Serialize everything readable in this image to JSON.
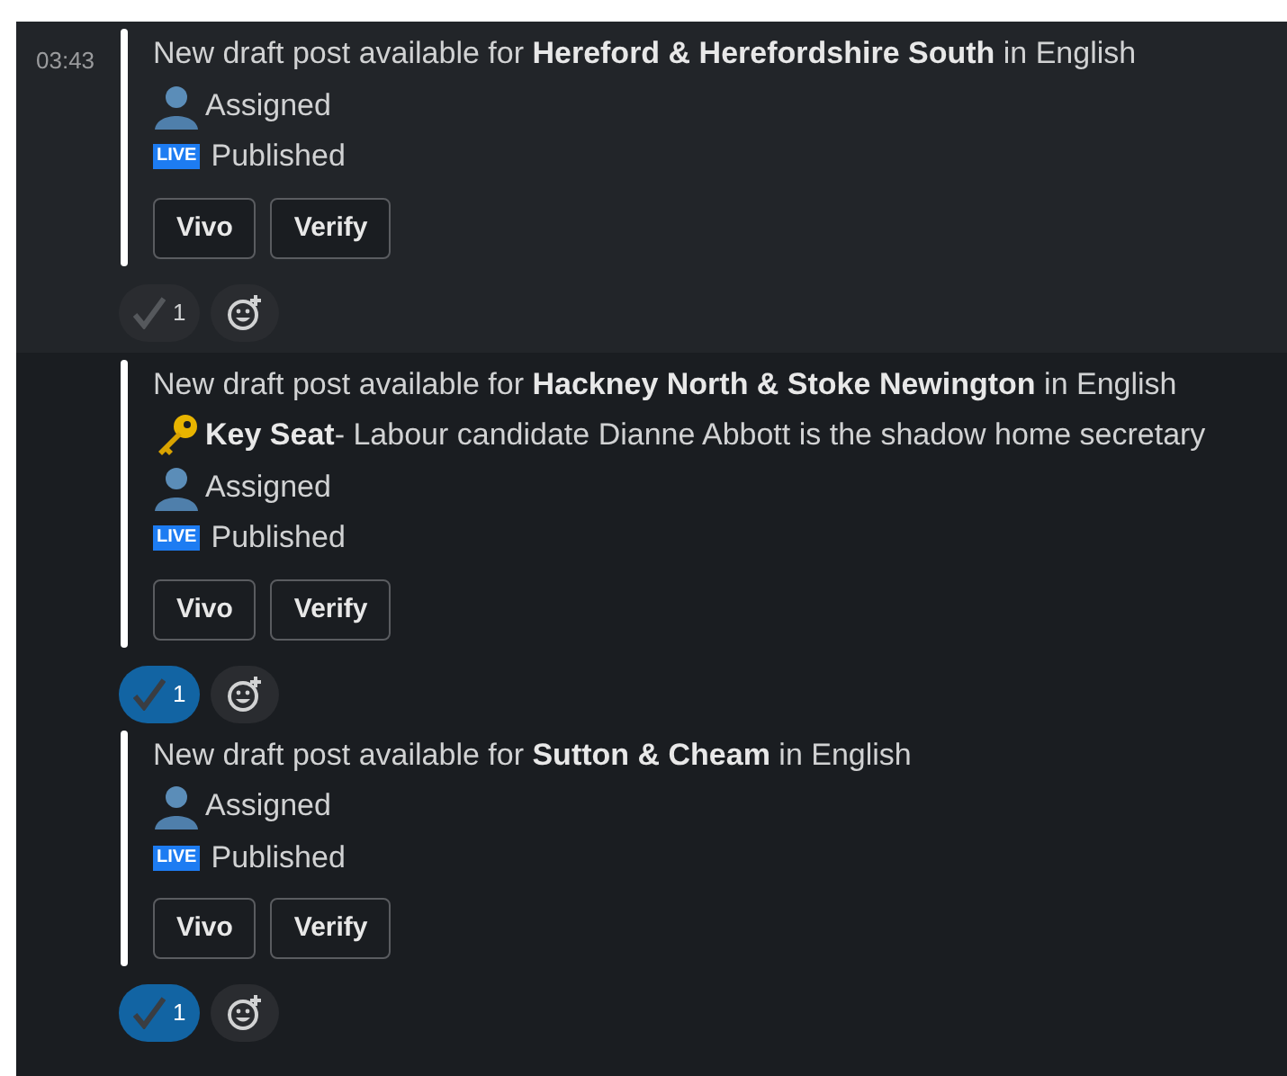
{
  "messages": [
    {
      "time": "03:43",
      "highlighted": true,
      "lines": [
        {
          "kind": "text",
          "text": "New draft post available for **Hereford & Herefordshire South** in English"
        },
        {
          "kind": "assigned",
          "text": "Assigned"
        },
        {
          "kind": "live",
          "badge": "LIVE",
          "text": "Published"
        }
      ],
      "buttons": [
        "Vivo",
        "Verify"
      ],
      "reaction": {
        "count": "1",
        "selected": false
      }
    },
    {
      "highlighted": false,
      "lines": [
        {
          "kind": "text",
          "text": "New draft post available for **Hackney North & Stoke Newington** in English"
        },
        {
          "kind": "key",
          "text": "**Key Seat**- Labour candidate Dianne Abbott is the shadow home secretary"
        },
        {
          "kind": "assigned",
          "text": "Assigned"
        },
        {
          "kind": "live",
          "badge": "LIVE",
          "text": "Published"
        }
      ],
      "buttons": [
        "Vivo",
        "Verify"
      ],
      "reaction": {
        "count": "1",
        "selected": true
      }
    },
    {
      "highlighted": false,
      "lines": [
        {
          "kind": "text",
          "text": "New draft post available for **Sutton & Cheam** in English"
        },
        {
          "kind": "assigned",
          "text": "Assigned"
        },
        {
          "kind": "live",
          "badge": "LIVE",
          "text": "Published"
        }
      ],
      "buttons": [
        "Vivo",
        "Verify"
      ],
      "reaction": {
        "count": "1",
        "selected": true
      }
    }
  ]
}
